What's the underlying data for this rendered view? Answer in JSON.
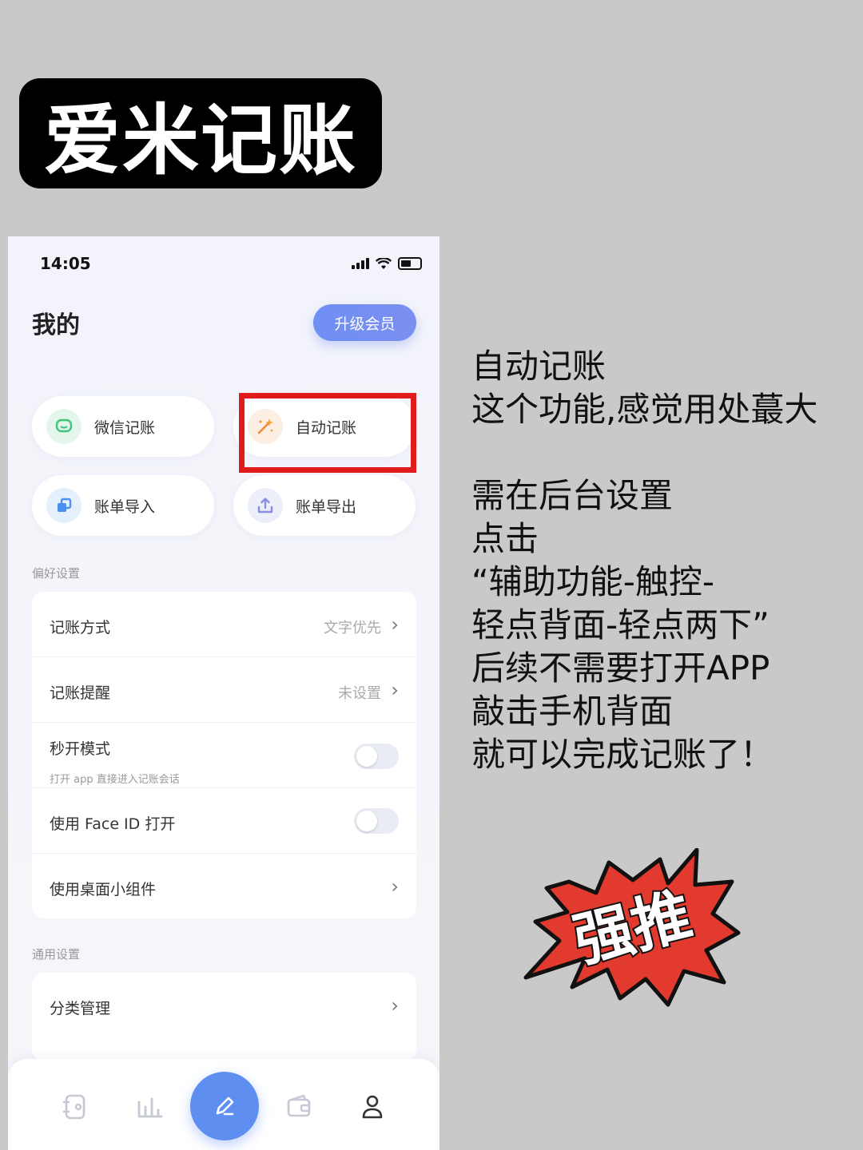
{
  "header": {
    "title": "爱米记账"
  },
  "status_bar": {
    "time": "14:05"
  },
  "page": {
    "title": "我的",
    "upgrade_button": "升级会员"
  },
  "quick_actions": [
    {
      "label": "微信记账",
      "icon": "wechat-icon"
    },
    {
      "label": "自动记账",
      "icon": "magic-wand-icon"
    },
    {
      "label": "账单导入",
      "icon": "import-icon"
    },
    {
      "label": "账单导出",
      "icon": "export-icon"
    }
  ],
  "preferences": {
    "section_label": "偏好设置",
    "rows": [
      {
        "label": "记账方式",
        "value": "文字优先"
      },
      {
        "label": "记账提醒",
        "value": "未设置"
      },
      {
        "label": "秒开模式",
        "sublabel": "打开 app 直接进入记账会话",
        "toggle": false
      },
      {
        "label": "使用 Face ID 打开",
        "toggle": false
      },
      {
        "label": "使用桌面小组件"
      }
    ]
  },
  "general": {
    "section_label": "通用设置",
    "rows": [
      {
        "label": "分类管理"
      }
    ]
  },
  "tab_bar": {
    "items": [
      "notebook-icon",
      "chart-icon",
      "pen-icon",
      "wallet-icon",
      "person-icon"
    ],
    "accent": "#5e8ef0"
  },
  "annotation": {
    "lines": [
      "自动记账",
      "这个功能,感觉用处蕞大",
      "",
      "需在后台设置",
      "点击",
      "“辅助功能-触控-",
      "轻点背面-轻点两下”",
      "后续不需要打开APP",
      "敲击手机背面",
      "就可以完成记账了！"
    ]
  },
  "sticker": {
    "text": "强推",
    "color": "#e23a2e"
  }
}
